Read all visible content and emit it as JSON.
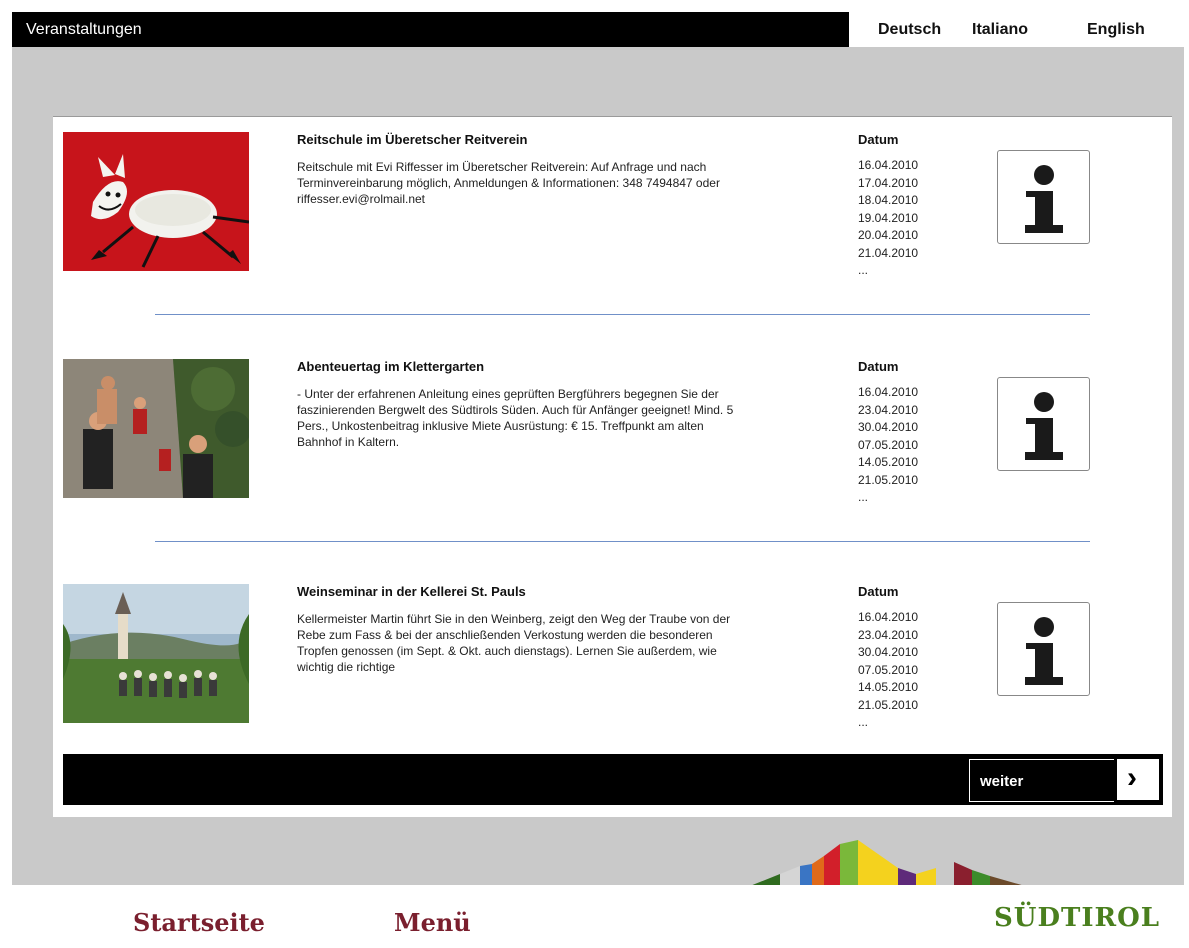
{
  "header": {
    "title": "Veranstaltungen",
    "languages": [
      "Deutsch",
      "Italiano",
      "English"
    ]
  },
  "events": [
    {
      "title": "Reitschule im Überetscher Reitverein",
      "description": "Reitschule mit Evi Riffesser im Überetscher Reitverein: Auf Anfrage und nach Terminvereinbarung möglich, Anmeldungen & Informationen: 348 7494847 oder riffesser.evi@rolmail.net",
      "datum_label": "Datum",
      "dates": [
        "16.04.2010",
        "17.04.2010",
        "18.04.2010",
        "19.04.2010",
        "20.04.2010",
        "21.04.2010",
        "..."
      ]
    },
    {
      "title": "Abenteuertag im Klettergarten",
      "description": "- Unter der erfahrenen Anleitung eines geprüften Bergführers begegnen Sie der faszinierenden Bergwelt des Südtirols Süden. Auch für Anfänger geeignet! Mind. 5 Pers., Unkostenbeitrag inklusive Miete Ausrüstung: € 15. Treffpunkt am alten Bahnhof in Kaltern.",
      "datum_label": "Datum",
      "dates": [
        "16.04.2010",
        "23.04.2010",
        "30.04.2010",
        "07.05.2010",
        "14.05.2010",
        "21.05.2010",
        "..."
      ]
    },
    {
      "title": "Weinseminar in der Kellerei St. Pauls",
      "description": "Kellermeister Martin führt Sie in den Weinberg, zeigt den Weg der Traube von der Rebe zum Fass & bei der anschließenden Verkostung werden die besonderen Tropfen genossen (im Sept. & Okt. auch dienstags). Lernen Sie außerdem, wie wichtig die richtige",
      "datum_label": "Datum",
      "dates": [
        "16.04.2010",
        "23.04.2010",
        "30.04.2010",
        "07.05.2010",
        "14.05.2010",
        "21.05.2010",
        "..."
      ]
    }
  ],
  "pagination": {
    "next_label": "weiter",
    "arrow": "›"
  },
  "footer": {
    "nav": [
      "Startseite",
      "Menü"
    ],
    "brand": "SÜDTIROL"
  },
  "colors": {
    "nav_text": "#7a1f2e",
    "brand_green": "#4a7f1e",
    "separator": "#7090c8"
  }
}
